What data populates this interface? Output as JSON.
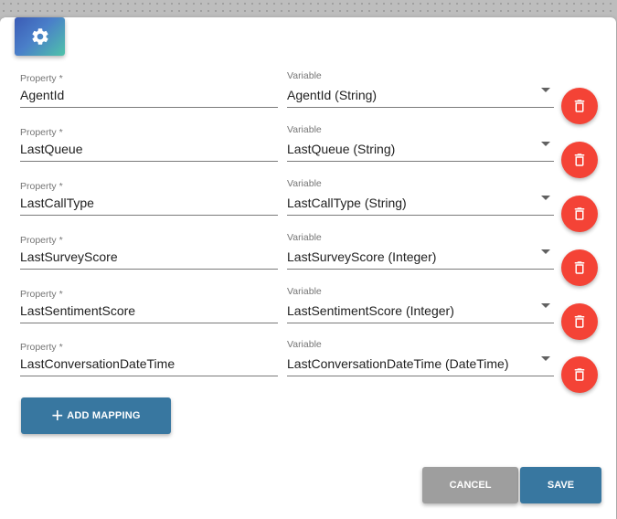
{
  "colors": {
    "primary": "#3877a0",
    "danger": "#f44336",
    "cancel": "#9e9e9e"
  },
  "header": {
    "icon": "gear-icon"
  },
  "mappings": [
    {
      "property_label": "Property *",
      "property": "AgentId",
      "variable_label": "Variable",
      "variable": "AgentId (String)"
    },
    {
      "property_label": "Property *",
      "property": "LastQueue",
      "variable_label": "Variable",
      "variable": "LastQueue (String)"
    },
    {
      "property_label": "Property *",
      "property": "LastCallType",
      "variable_label": "Variable",
      "variable": "LastCallType (String)"
    },
    {
      "property_label": "Property *",
      "property": "LastSurveyScore",
      "variable_label": "Variable",
      "variable": "LastSurveyScore (Integer)"
    },
    {
      "property_label": "Property *",
      "property": "LastSentimentScore",
      "variable_label": "Variable",
      "variable": "LastSentimentScore (Integer)"
    },
    {
      "property_label": "Property *",
      "property": "LastConversationDateTime",
      "variable_label": "Variable",
      "variable": "LastConversationDateTime (DateTime)"
    }
  ],
  "actions": {
    "add_mapping": "ADD MAPPING",
    "cancel": "CANCEL",
    "save": "SAVE"
  }
}
